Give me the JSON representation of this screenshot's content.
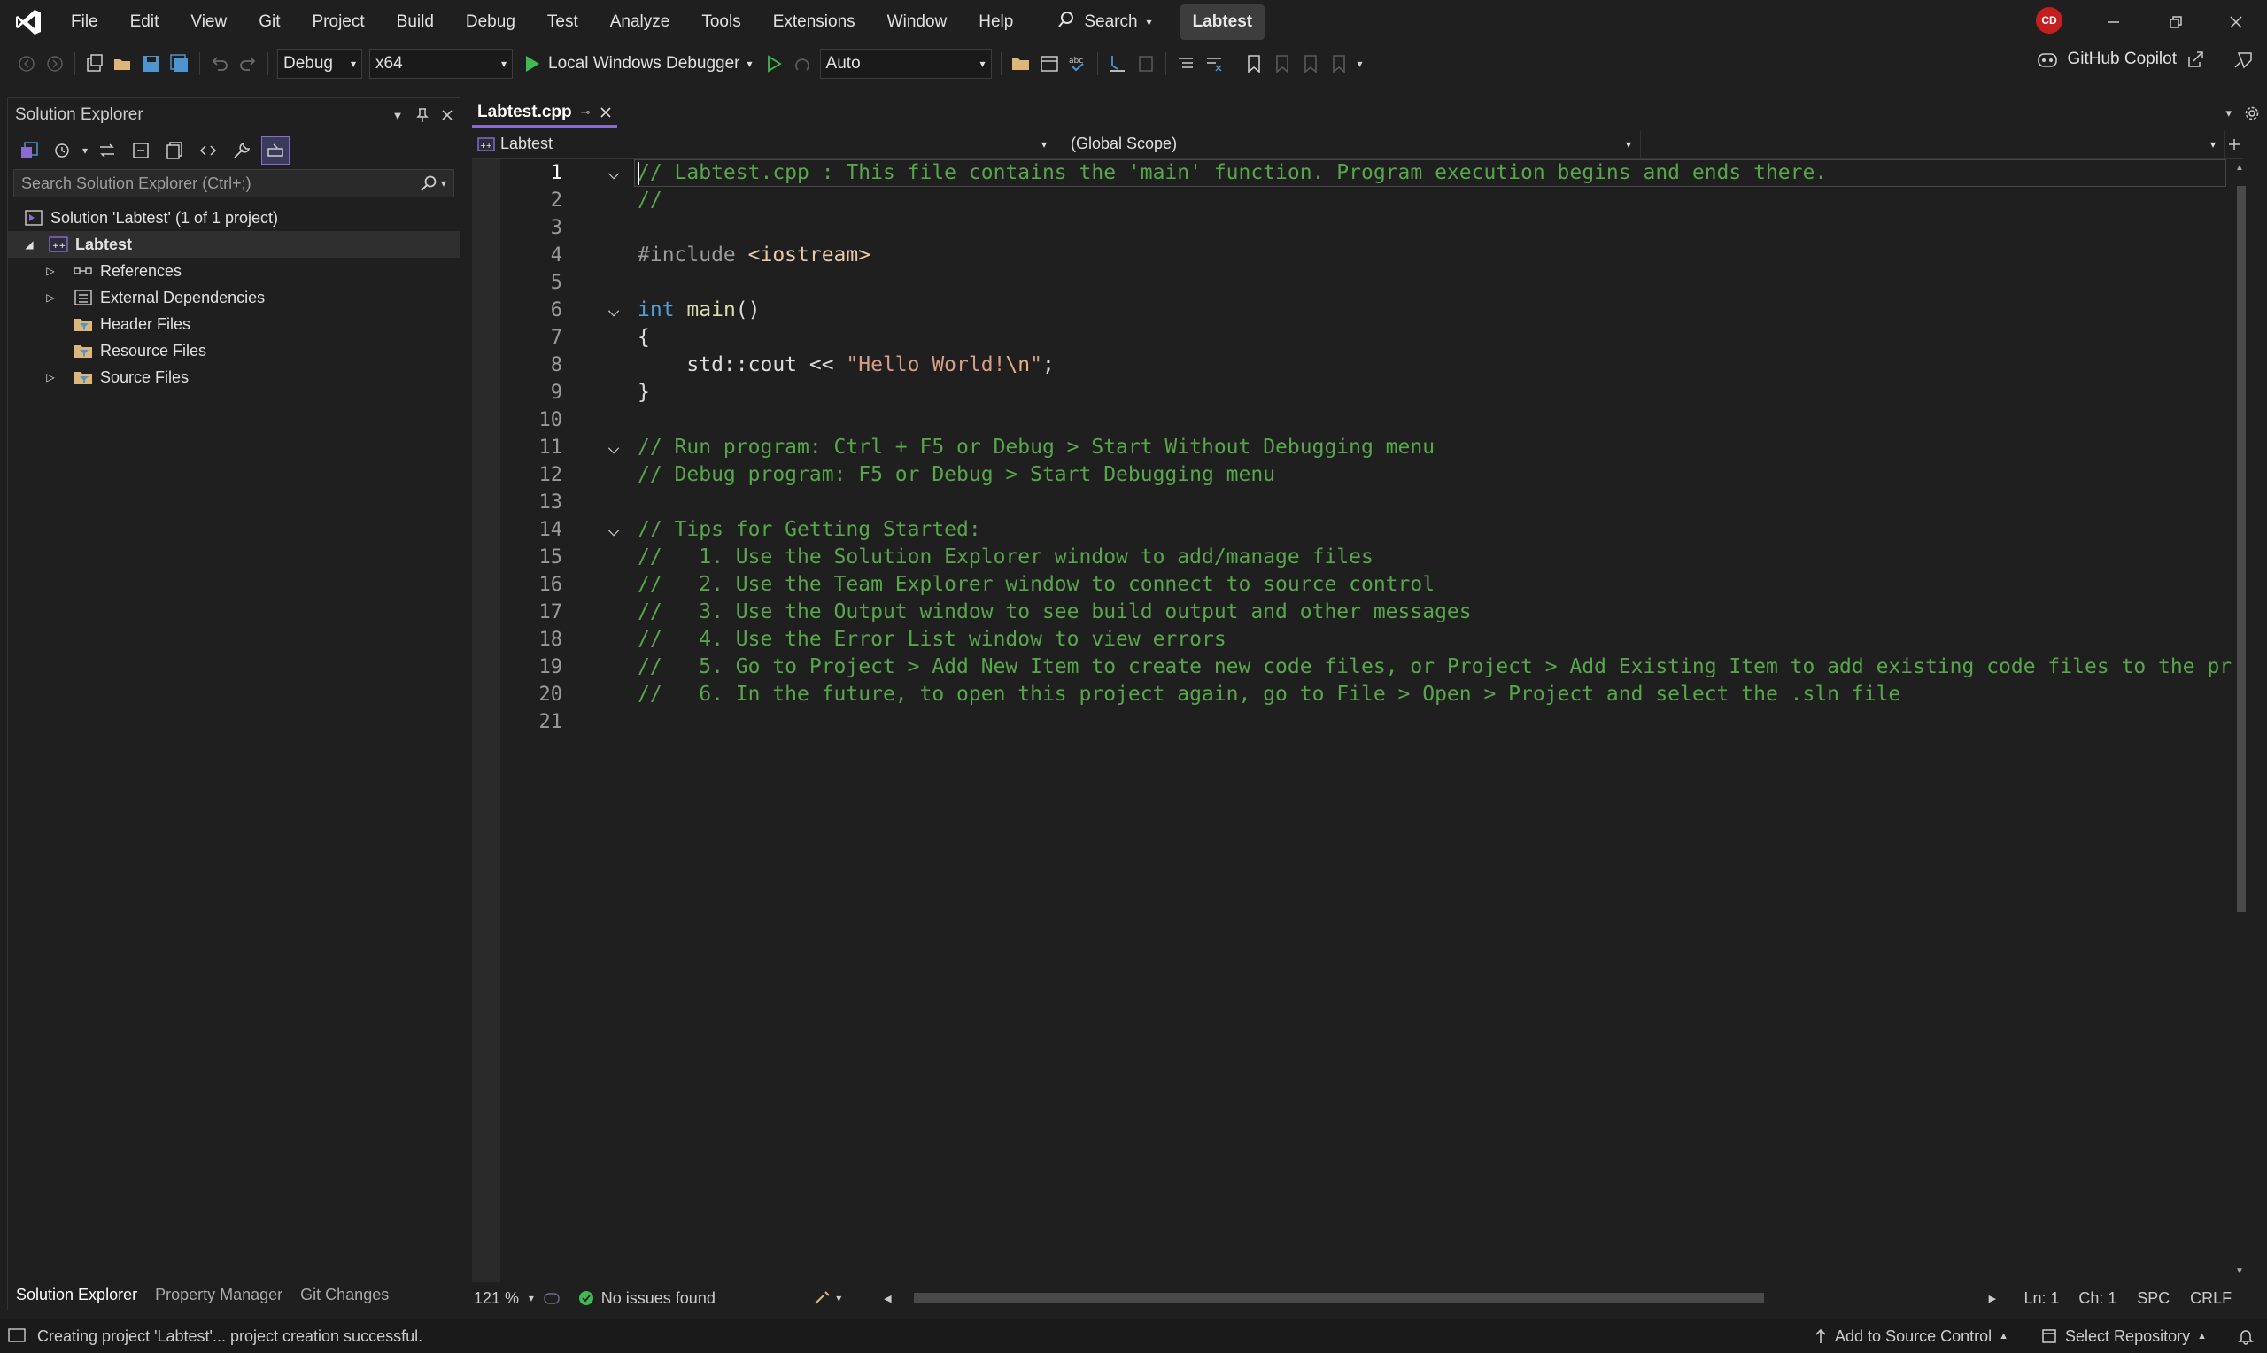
{
  "menu": [
    "File",
    "Edit",
    "View",
    "Git",
    "Project",
    "Build",
    "Debug",
    "Test",
    "Analyze",
    "Tools",
    "Extensions",
    "Window",
    "Help"
  ],
  "search_label": "Search",
  "solution_name": "Labtest",
  "avatar_initials": "CD",
  "toolbar": {
    "configuration": "Debug",
    "platform": "x64",
    "run_label": "Local Windows Debugger",
    "auto_combo": "Auto",
    "copilot_label": "GitHub Copilot"
  },
  "solution_explorer": {
    "title": "Solution Explorer",
    "search_placeholder": "Search Solution Explorer (Ctrl+;)",
    "solution_label": "Solution 'Labtest' (1 of 1 project)",
    "project": "Labtest",
    "items": [
      {
        "label": "References",
        "expandable": true
      },
      {
        "label": "External Dependencies",
        "expandable": true
      },
      {
        "label": "Header Files",
        "expandable": false
      },
      {
        "label": "Resource Files",
        "expandable": false
      },
      {
        "label": "Source Files",
        "expandable": true
      }
    ],
    "bottom_tabs": [
      "Solution Explorer",
      "Property Manager",
      "Git Changes"
    ]
  },
  "editor": {
    "file_tab": "Labtest.cpp",
    "project_combo": "Labtest",
    "scope_combo": "(Global Scope)",
    "current_line": 1,
    "lines": [
      "// Labtest.cpp : This file contains the 'main' function. Program execution begins and ends there.",
      "//",
      "",
      "#include <iostream>",
      "",
      "int main()",
      "{",
      "    std::cout << \"Hello World!\\n\";",
      "}",
      "",
      "// Run program: Ctrl + F5 or Debug > Start Without Debugging menu",
      "// Debug program: F5 or Debug > Start Debugging menu",
      "",
      "// Tips for Getting Started:",
      "//   1. Use the Solution Explorer window to add/manage files",
      "//   2. Use the Team Explorer window to connect to source control",
      "//   3. Use the Output window to see build output and other messages",
      "//   4. Use the Error List window to view errors",
      "//   5. Go to Project > Add New Item to create new code files, or Project > Add Existing Item to add existing code files to the pr",
      "//   6. In the future, to open this project again, go to File > Open > Project and select the .sln file",
      ""
    ],
    "fold_lines": [
      1,
      6,
      11,
      14
    ]
  },
  "editor_status": {
    "zoom": "121 %",
    "issues": "No issues found",
    "ln": "Ln: 1",
    "ch": "Ch: 1",
    "spacing": "SPC",
    "line_ending": "CRLF"
  },
  "statusbar": {
    "message": "Creating project 'Labtest'... project creation successful.",
    "source_control": "Add to Source Control",
    "repository": "Select Repository"
  },
  "colors": {
    "accent": "#8a6cd1",
    "comment": "#57a64a",
    "keyword": "#569cd6",
    "string": "#d69d85",
    "run_green": "#3fb950"
  }
}
